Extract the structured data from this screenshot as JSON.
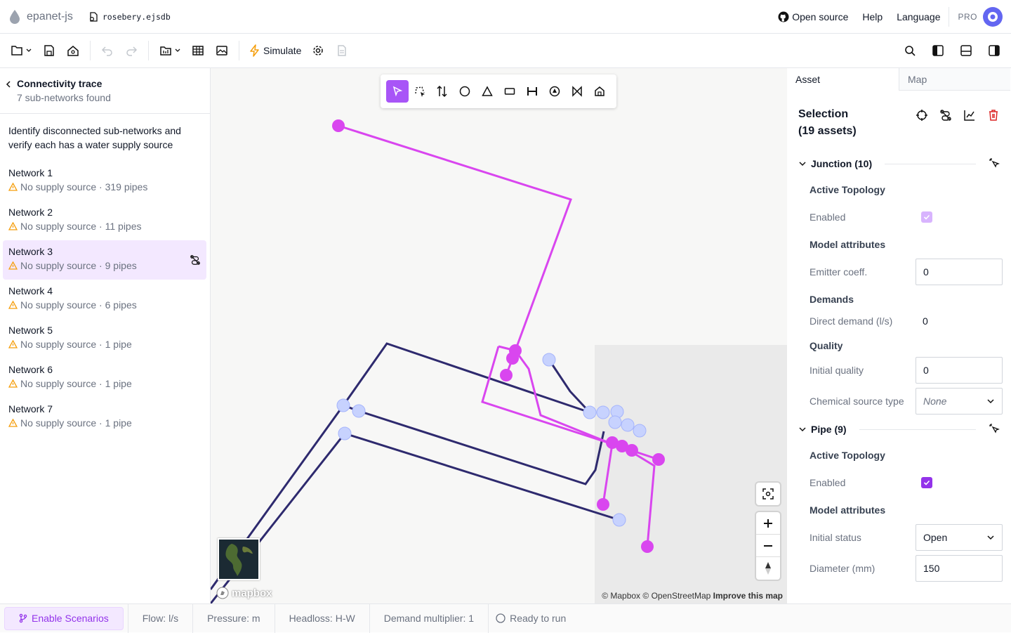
{
  "app": {
    "name": "epanet-js",
    "file": "rosebery.ejsdb"
  },
  "topnav": {
    "open_source": "Open source",
    "help": "Help",
    "language": "Language",
    "pro": "PRO"
  },
  "toolbar": {
    "simulate": "Simulate"
  },
  "trace": {
    "title": "Connectivity trace",
    "subtitle": "7 sub-networks found",
    "description": "Identify disconnected sub-networks and verify each has a water supply source",
    "networks": [
      {
        "name": "Network 1",
        "status": "No supply source · 319 pipes"
      },
      {
        "name": "Network 2",
        "status": "No supply source · 11 pipes"
      },
      {
        "name": "Network 3",
        "status": "No supply source · 9 pipes"
      },
      {
        "name": "Network 4",
        "status": "No supply source · 6 pipes"
      },
      {
        "name": "Network 5",
        "status": "No supply source · 1 pipe"
      },
      {
        "name": "Network 6",
        "status": "No supply source · 1 pipe"
      },
      {
        "name": "Network 7",
        "status": "No supply source · 1 pipe"
      }
    ]
  },
  "map": {
    "attribution_mapbox": "© Mapbox",
    "attribution_osm": "© OpenStreetMap",
    "improve": "Improve this map",
    "logo": "mapbox"
  },
  "panel": {
    "tabs": [
      "Asset",
      "Map"
    ],
    "selection_title": "Selection",
    "selection_count": "(19 assets)",
    "junction": {
      "title": "Junction (10)",
      "active_topology": "Active Topology",
      "enabled": "Enabled",
      "model_attributes": "Model attributes",
      "emitter_label": "Emitter coeff.",
      "emitter_value": "0",
      "demands": "Demands",
      "direct_demand_label": "Direct demand (l/s)",
      "direct_demand_value": "0",
      "quality": "Quality",
      "initial_quality_label": "Initial quality",
      "initial_quality_value": "0",
      "chem_label": "Chemical source type",
      "chem_value": "None"
    },
    "pipe": {
      "title": "Pipe (9)",
      "active_topology": "Active Topology",
      "enabled": "Enabled",
      "model_attributes": "Model attributes",
      "status_label": "Initial status",
      "status_value": "Open",
      "diameter_label": "Diameter (mm)",
      "diameter_value": "150"
    }
  },
  "footer": {
    "scenarios": "Enable Scenarios",
    "flow": "Flow: l/s",
    "pressure": "Pressure: m",
    "headloss": "Headloss: H-W",
    "demand": "Demand multiplier: 1",
    "status": "Ready to run"
  },
  "colors": {
    "accent": "#a855f7",
    "selected": "#d946ef",
    "pipe": "#2e2a6e",
    "node": "#c7d2fe",
    "warn": "#f59e0b"
  }
}
